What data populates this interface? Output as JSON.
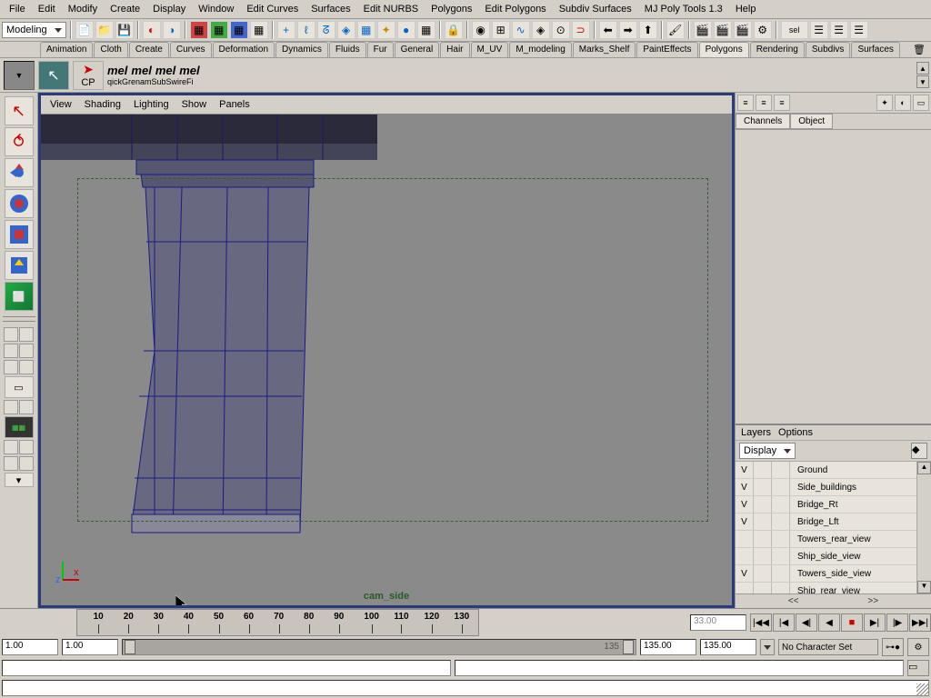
{
  "menu": [
    "File",
    "Edit",
    "Modify",
    "Create",
    "Display",
    "Window",
    "Edit Curves",
    "Surfaces",
    "Edit NURBS",
    "Polygons",
    "Edit Polygons",
    "Subdiv Surfaces",
    "MJ Poly Tools 1.3",
    "Help"
  ],
  "mode_dropdown": "Modeling",
  "shelf_tabs": [
    "Animation",
    "Cloth",
    "Create",
    "Curves",
    "Deformation",
    "Dynamics",
    "Fluids",
    "Fur",
    "General",
    "Hair",
    "M_UV",
    "M_modeling",
    "Marks_Shelf",
    "PaintEffects",
    "Polygons",
    "Rendering",
    "Subdivs",
    "Surfaces"
  ],
  "shelf_active": "Polygons",
  "shelf_items": {
    "cp": "CP",
    "sub": "qickGrenamSubS​wireFi"
  },
  "mel_labels": [
    "mel",
    "mel",
    "mel",
    "mel"
  ],
  "panel_menu": [
    "View",
    "Shading",
    "Lighting",
    "Show",
    "Panels"
  ],
  "viewport_label": "cam_side",
  "channel_tabs": [
    "Channels",
    "Object"
  ],
  "layers_header": [
    "Layers",
    "Options"
  ],
  "layers_dropdown": "Display",
  "layers": [
    {
      "v": "V",
      "name": "Ground"
    },
    {
      "v": "V",
      "name": "Side_buildings"
    },
    {
      "v": "V",
      "name": "Bridge_Rt"
    },
    {
      "v": "V",
      "name": "Bridge_Lft"
    },
    {
      "v": "",
      "name": "Towers_rear_view"
    },
    {
      "v": "",
      "name": "Ship_side_view"
    },
    {
      "v": "V",
      "name": "Towers_side_view"
    },
    {
      "v": "",
      "name": "Ship_rear_view"
    }
  ],
  "timeline": {
    "ticks": [
      "10",
      "20",
      "30",
      "40",
      "50",
      "60",
      "70",
      "80",
      "90",
      "100",
      "110",
      "120",
      "130"
    ],
    "current": "33.00"
  },
  "range": {
    "start": "1.00",
    "startB": "1.00",
    "end": "135.00",
    "endB": "135.00",
    "handle_end": "135"
  },
  "char_set": "No Character Set",
  "playback_nav": {
    "back": "<<",
    "fwd": ">>"
  }
}
